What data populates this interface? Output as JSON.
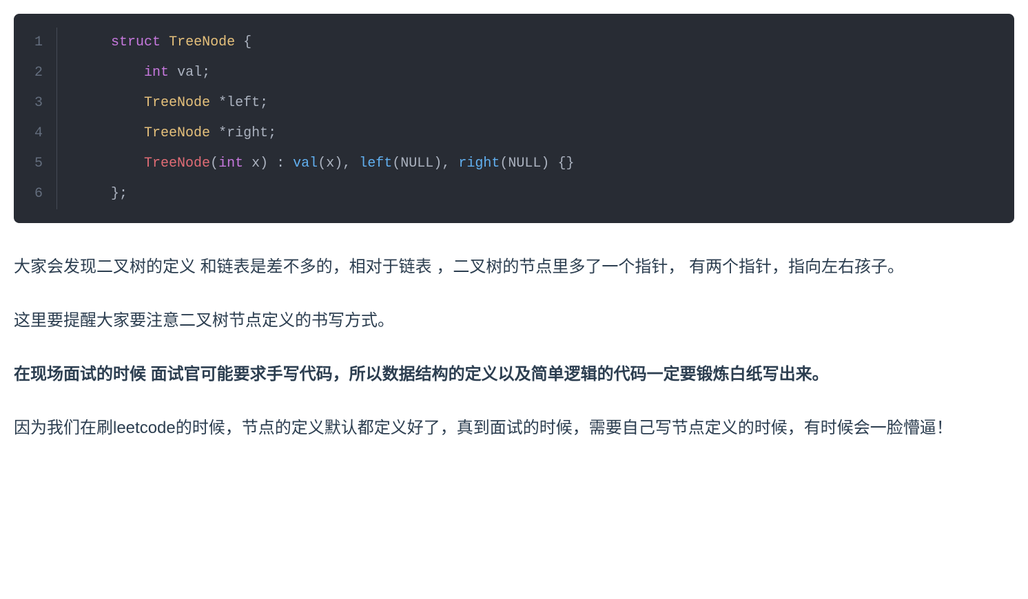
{
  "code": {
    "line_numbers": [
      "1",
      "2",
      "3",
      "4",
      "5",
      "6"
    ],
    "line1": {
      "indent": "    ",
      "struct": "struct",
      "sp1": " ",
      "typename": "TreeNode",
      "sp2": " ",
      "brace": "{"
    },
    "line2": {
      "indent": "        ",
      "int": "int",
      "sp1": " ",
      "ident": "val",
      "semi": ";"
    },
    "line3": {
      "indent": "        ",
      "typename": "TreeNode",
      "sp1": " ",
      "star": "*",
      "ident": "left",
      "semi": ";"
    },
    "line4": {
      "indent": "        ",
      "typename": "TreeNode",
      "sp1": " ",
      "star": "*",
      "ident": "right",
      "semi": ";"
    },
    "line5": {
      "indent": "        ",
      "ctor": "TreeNode",
      "lp1": "(",
      "int": "int",
      "sp1": " ",
      "param": "x",
      "rp1": ")",
      "sp2": " ",
      "colon": ":",
      "sp3": " ",
      "val_call": "val",
      "lp2": "(",
      "x": "x",
      "rp2": ")",
      "comma1": ",",
      "sp4": " ",
      "left_call": "left",
      "lp3": "(",
      "null1": "NULL",
      "rp3": ")",
      "comma2": ",",
      "sp5": " ",
      "right_call": "right",
      "lp4": "(",
      "null2": "NULL",
      "rp4": ")",
      "sp6": " ",
      "lb": "{",
      "rb": "}"
    },
    "line6": {
      "indent": "    ",
      "brace": "}",
      "semi": ";"
    }
  },
  "para1": "大家会发现二叉树的定义 和链表是差不多的，相对于链表 ，二叉树的节点里多了一个指针， 有两个指针，指向左右孩子。",
  "para2": "这里要提醒大家要注意二叉树节点定义的书写方式。",
  "para3_bold": "在现场面试的时候 面试官可能要求手写代码，所以数据结构的定义以及简单逻辑的代码一定要锻炼白纸写出来。",
  "para4": "因为我们在刷leetcode的时候，节点的定义默认都定义好了，真到面试的时候，需要自己写节点定义的时候，有时候会一脸懵逼！"
}
